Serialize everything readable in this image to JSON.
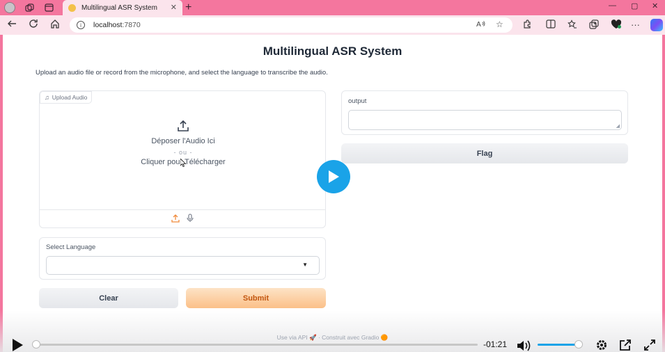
{
  "browser": {
    "tab_title": "Multilingual ASR System",
    "tab_close": "✕",
    "new_tab": "+",
    "url_host": "localhost",
    "url_port": ":7870",
    "win_min": "—",
    "win_max": "▢",
    "win_close": "✕"
  },
  "app": {
    "title": "Multilingual ASR System",
    "description": "Upload an audio file or record from the microphone, and select the language to transcribe the audio.",
    "upload": {
      "label": "Upload Audio",
      "drop_text": "Déposer l'Audio Ici",
      "or_text": "- ou -",
      "click_text": "Cliquer pour Télécharger"
    },
    "language": {
      "label": "Select Language",
      "value": ""
    },
    "buttons": {
      "clear": "Clear",
      "submit": "Submit",
      "flag": "Flag"
    },
    "output": {
      "label": "output",
      "value": ""
    },
    "footer": {
      "api": "Use via API",
      "built": "Construit avec Gradio"
    }
  },
  "video": {
    "time_remaining": "-01:21",
    "progress": 0.0,
    "volume": 0.9
  },
  "colors": {
    "browser_frame": "#f4769e",
    "submit_text": "#c2560f",
    "play_button": "#1aa3e8"
  }
}
